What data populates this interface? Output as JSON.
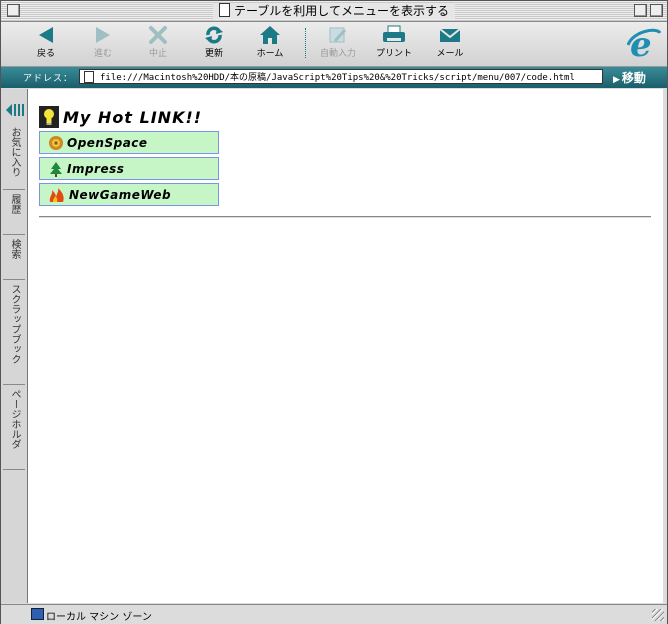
{
  "window": {
    "title": "テーブルを利用してメニューを表示する"
  },
  "toolbar": {
    "back": "戻る",
    "forward": "進む",
    "stop": "中止",
    "refresh": "更新",
    "home": "ホーム",
    "autofill": "自動入力",
    "print": "プリント",
    "mail": "メール"
  },
  "address": {
    "label": "アドレス：",
    "url": "file:///Macintosh%20HDD/本の原稿/JavaScript%20Tips%20&%20Tricks/script/menu/007/code.html",
    "go": "移動"
  },
  "explorer_tabs": [
    "お気に入り",
    "履歴",
    "検索",
    "スクラップブック",
    "ページホルダ"
  ],
  "page": {
    "heading": "My Hot LINK!!",
    "links": [
      "OpenSpace",
      "Impress",
      "NewGameWeb"
    ]
  },
  "status": {
    "zone": "ローカル マシン ゾーン"
  },
  "colors": {
    "accent": "#1b7a86",
    "menu_bg": "#c6f5c6",
    "menu_border": "#7a95e8"
  }
}
